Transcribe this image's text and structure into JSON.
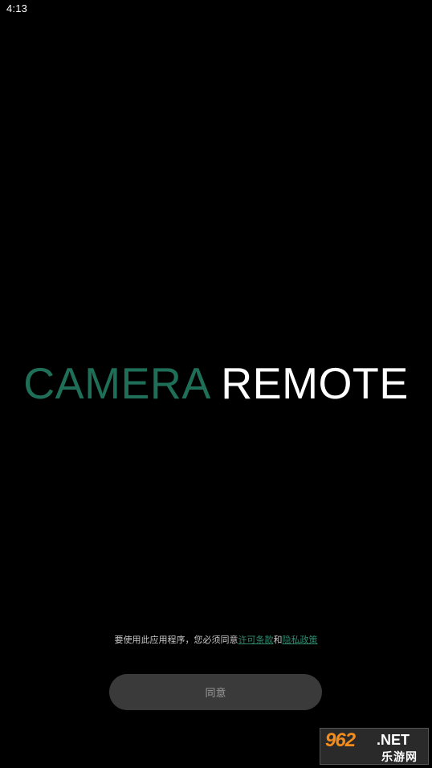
{
  "status_bar": {
    "time": "4:13"
  },
  "logo": {
    "word1": "CAMERA",
    "word2": "REMOTE",
    "word1_color": "#1e6e58",
    "word2_color": "#ffffff"
  },
  "consent": {
    "prefix": "要使用此应用程序，您必须同意",
    "license_link": "许可条款",
    "joiner": "和",
    "privacy_link": "隐私政策",
    "link_color": "#2f8a6e"
  },
  "agree_button": {
    "label": "同意"
  },
  "watermark": {
    "number": "962",
    "domain": ".NET",
    "chinese": "乐游网"
  }
}
